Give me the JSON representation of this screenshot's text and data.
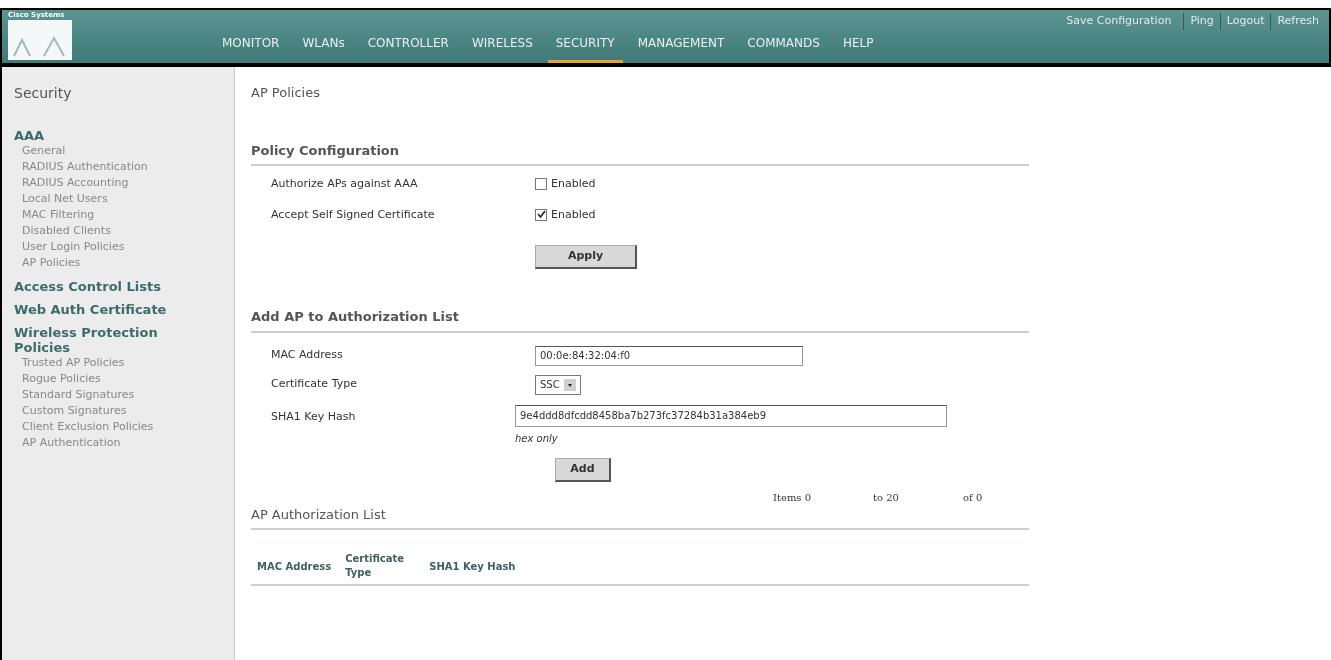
{
  "header": {
    "logo_text": "Cisco Systems",
    "top_links": [
      "Save Configuration",
      "Ping",
      "Logout",
      "Refresh"
    ],
    "nav": [
      {
        "label": "MONITOR",
        "selected": false
      },
      {
        "label": "WLANs",
        "selected": false
      },
      {
        "label": "CONTROLLER",
        "selected": false
      },
      {
        "label": "WIRELESS",
        "selected": false
      },
      {
        "label": "SECURITY",
        "selected": true
      },
      {
        "label": "MANAGEMENT",
        "selected": false
      },
      {
        "label": "COMMANDS",
        "selected": false
      },
      {
        "label": "HELP",
        "selected": false
      }
    ]
  },
  "sidebar": {
    "title": "Security",
    "groups": [
      {
        "label": "AAA",
        "items": [
          "General",
          "RADIUS Authentication",
          "RADIUS Accounting",
          "Local Net Users",
          "MAC Filtering",
          "Disabled Clients",
          "User Login Policies",
          "AP Policies"
        ]
      },
      {
        "label": "Access Control Lists"
      },
      {
        "label": "Web Auth Certificate"
      },
      {
        "label": "Wireless Protection Policies",
        "items": [
          "Trusted AP Policies",
          "Rogue Policies",
          "Standard Signatures",
          "Custom Signatures",
          "Client Exclusion Policies",
          "AP Authentication"
        ]
      }
    ]
  },
  "page_title": "AP Policies",
  "policy_configuration": {
    "heading": "Policy Configuration",
    "rows": [
      {
        "label": "Authorize APs against AAA",
        "option": "Enabled",
        "checked": false
      },
      {
        "label": "Accept Self Signed Certificate",
        "option": "Enabled",
        "checked": true
      }
    ],
    "button": "Apply"
  },
  "add_ap": {
    "heading": "Add AP to Authorization List",
    "mac_label": "MAC Address",
    "mac_value": "00:0e:84:32:04:f0",
    "cert_label": "Certificate Type",
    "cert_value": "SSC",
    "sha_label": "SHA1 Key Hash",
    "sha_value": "9e4ddd8dfcdd8458ba7b273fc37284b31a384eb9",
    "sha_hint": "hex only",
    "button": "Add"
  },
  "pager": {
    "items": "Items 0",
    "to": "to 20",
    "of": "of 0"
  },
  "authorization_list": {
    "heading": "AP Authorization List",
    "columns": [
      "MAC Address",
      "Certificate Type",
      "SHA1 Key Hash"
    ]
  }
}
